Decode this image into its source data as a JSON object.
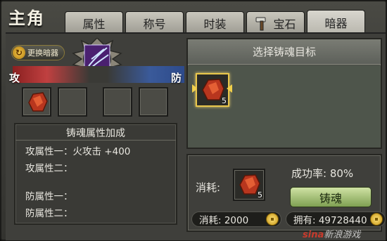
{
  "window": {
    "title": "主角"
  },
  "tabs": [
    {
      "label": "属性",
      "active": false
    },
    {
      "label": "称号",
      "active": false
    },
    {
      "label": "时装",
      "active": false
    },
    {
      "label": "宝石",
      "active": false,
      "icon": "hammer-icon"
    },
    {
      "label": "暗器",
      "active": true
    }
  ],
  "left": {
    "swap_button": "更换暗器",
    "attack_label": "攻",
    "defense_label": "防",
    "panel_title": "铸魂属性加成",
    "attributes": [
      {
        "label": "攻属性一：",
        "value": "火攻击 +400"
      },
      {
        "label": "攻属性二：",
        "value": ""
      },
      {
        "label": "防属性一：",
        "value": ""
      },
      {
        "label": "防属性二：",
        "value": ""
      }
    ]
  },
  "right": {
    "target_title": "选择铸魂目标",
    "selected_item_count": "5",
    "cost_label": "消耗:",
    "cost_item_count": "5",
    "success_rate": "成功率: 80%",
    "forge_button": "铸魂",
    "gold_cost": "消耗: 2000",
    "gold_owned": "拥有: 49728440"
  },
  "watermark": {
    "brand": "sina",
    "text": "新浪游戏"
  },
  "colors": {
    "accent_gold": "#e9c64b",
    "attack": "#c04040",
    "defense": "#3a5a9a"
  }
}
